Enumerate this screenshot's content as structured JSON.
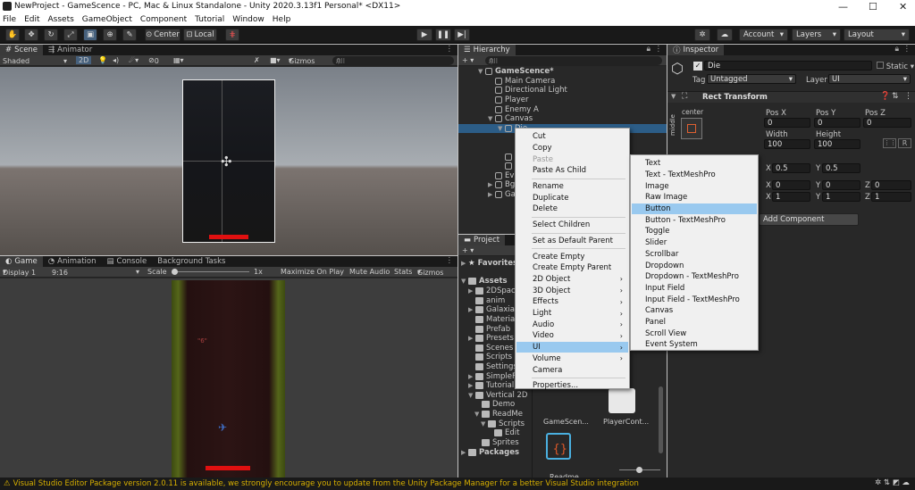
{
  "window": {
    "title": "NewProject - GameScence - PC, Mac & Linux Standalone - Unity 2020.3.13f1 Personal* <DX11>"
  },
  "menu": [
    "File",
    "Edit",
    "Assets",
    "GameObject",
    "Component",
    "Tutorial",
    "Window",
    "Help"
  ],
  "toolbar": {
    "center": "Center",
    "local": "Local",
    "account": "Account",
    "layers": "Layers",
    "layout": "Layout"
  },
  "scene": {
    "tabs": [
      "Scene",
      "Animator"
    ],
    "shading": "Shaded",
    "mode2d": "2D",
    "count": "0",
    "gizmos": "Gizmos",
    "search": "All"
  },
  "game": {
    "tabs": [
      "Game",
      "Animation",
      "Console",
      "Background Tasks"
    ],
    "display": "Display 1",
    "aspect": "9:16",
    "scale_label": "Scale",
    "scale_value": "1x",
    "maximize": "Maximize On Play",
    "mute": "Mute Audio",
    "stats": "Stats",
    "gizmos": "Gizmos",
    "score": "\"6\""
  },
  "hierarchy": {
    "title": "Hierarchy",
    "search": "All",
    "items": [
      {
        "label": "GameScence*",
        "depth": 0,
        "arrow": "▼",
        "bold": true
      },
      {
        "label": "Main Camera",
        "depth": 1,
        "arrow": ""
      },
      {
        "label": "Directional Light",
        "depth": 1,
        "arrow": ""
      },
      {
        "label": "Player",
        "depth": 1,
        "arrow": ""
      },
      {
        "label": "Enemy A",
        "depth": 1,
        "arrow": ""
      },
      {
        "label": "Canvas",
        "depth": 1,
        "arrow": "▼"
      },
      {
        "label": "Die",
        "depth": 2,
        "arrow": "▼",
        "selected": true
      },
      {
        "label": "",
        "depth": 3,
        "arrow": ""
      },
      {
        "label": "",
        "depth": 3,
        "arrow": ""
      },
      {
        "label": "",
        "depth": 2,
        "arrow": ""
      },
      {
        "label": "",
        "depth": 2,
        "arrow": ""
      },
      {
        "label": "Ev",
        "depth": 1,
        "arrow": ""
      },
      {
        "label": "Bg",
        "depth": 1,
        "arrow": "▶"
      },
      {
        "label": "Ga",
        "depth": 1,
        "arrow": "▶"
      }
    ]
  },
  "project": {
    "title": "Project",
    "favorites": "Favorites",
    "assets": "Assets",
    "packages": "Packages",
    "tree": [
      {
        "label": "2DSpac",
        "depth": 1,
        "arrow": "▶"
      },
      {
        "label": "anim",
        "depth": 1,
        "arrow": ""
      },
      {
        "label": "Galaxia",
        "depth": 1,
        "arrow": "▶"
      },
      {
        "label": "Materia",
        "depth": 1,
        "arrow": ""
      },
      {
        "label": "Prefab",
        "depth": 1,
        "arrow": ""
      },
      {
        "label": "Presets",
        "depth": 1,
        "arrow": "▶"
      },
      {
        "label": "Scenes",
        "depth": 1,
        "arrow": ""
      },
      {
        "label": "Scripts",
        "depth": 1,
        "arrow": ""
      },
      {
        "label": "Settings",
        "depth": 1,
        "arrow": ""
      },
      {
        "label": "SimpleF",
        "depth": 1,
        "arrow": "▶"
      },
      {
        "label": "Tutorial",
        "depth": 1,
        "arrow": "▶"
      },
      {
        "label": "Vertical 2D",
        "depth": 1,
        "arrow": "▼"
      },
      {
        "label": "Demo",
        "depth": 2,
        "arrow": ""
      },
      {
        "label": "ReadMe",
        "depth": 2,
        "arrow": "▼"
      },
      {
        "label": "Scripts",
        "depth": 3,
        "arrow": "▼"
      },
      {
        "label": "Edit",
        "depth": 4,
        "arrow": ""
      },
      {
        "label": "Sprites",
        "depth": 2,
        "arrow": ""
      }
    ],
    "files": [
      "GameScen...",
      "PlayerCont...",
      "Readme"
    ]
  },
  "inspector": {
    "title": "Inspector",
    "name": "Die",
    "static": "Static",
    "tag_label": "Tag",
    "tag": "Untagged",
    "layer_label": "Layer",
    "layer": "UI",
    "component": "Rect Transform",
    "anchor": "center",
    "anchor_side": "middle",
    "posx_label": "Pos X",
    "posy_label": "Pos Y",
    "posz_label": "Pos Z",
    "posx": "0",
    "posy": "0",
    "posz": "0",
    "width_label": "Width",
    "height_label": "Height",
    "width": "100",
    "height": "100",
    "pivot_x": "0.5",
    "pivot_y": "0.5",
    "rot_x": "0",
    "rot_y": "0",
    "rot_z": "0",
    "scale_x": "1",
    "scale_y": "1",
    "scale_z": "1",
    "add_component": "Add Component"
  },
  "context_menu": {
    "items": [
      {
        "label": "Cut",
        "type": "item"
      },
      {
        "label": "Copy",
        "type": "item"
      },
      {
        "label": "Paste",
        "type": "disabled"
      },
      {
        "label": "Paste As Child",
        "type": "item"
      },
      {
        "type": "sep"
      },
      {
        "label": "Rename",
        "type": "item"
      },
      {
        "label": "Duplicate",
        "type": "item"
      },
      {
        "label": "Delete",
        "type": "item"
      },
      {
        "type": "sep"
      },
      {
        "label": "Select Children",
        "type": "item"
      },
      {
        "type": "sep"
      },
      {
        "label": "Set as Default Parent",
        "type": "item"
      },
      {
        "type": "sep"
      },
      {
        "label": "Create Empty",
        "type": "item"
      },
      {
        "label": "Create Empty Parent",
        "type": "item"
      },
      {
        "label": "2D Object",
        "type": "sub"
      },
      {
        "label": "3D Object",
        "type": "sub"
      },
      {
        "label": "Effects",
        "type": "sub"
      },
      {
        "label": "Light",
        "type": "sub"
      },
      {
        "label": "Audio",
        "type": "sub"
      },
      {
        "label": "Video",
        "type": "sub"
      },
      {
        "label": "UI",
        "type": "sub",
        "highlight": true
      },
      {
        "label": "Volume",
        "type": "sub"
      },
      {
        "label": "Camera",
        "type": "item"
      },
      {
        "type": "sep"
      },
      {
        "label": "Properties...",
        "type": "item"
      }
    ]
  },
  "ui_submenu": {
    "items": [
      "Text",
      "Text - TextMeshPro",
      "Image",
      "Raw Image",
      "Button",
      "Button - TextMeshPro",
      "Toggle",
      "Slider",
      "Scrollbar",
      "Dropdown",
      "Dropdown - TextMeshPro",
      "Input Field",
      "Input Field - TextMeshPro",
      "Canvas",
      "Panel",
      "Scroll View",
      "Event System"
    ],
    "highlight": "Button"
  },
  "status": {
    "message": "Visual Studio Editor Package version 2.0.11 is available, we strongly encourage you to update from the Unity Package Manager for a better Visual Studio integration"
  },
  "colors": {
    "selection": "#2c5d87",
    "menu_highlight": "#99c9ef",
    "warning": "#d8b000",
    "health_bar": "#e01010"
  }
}
